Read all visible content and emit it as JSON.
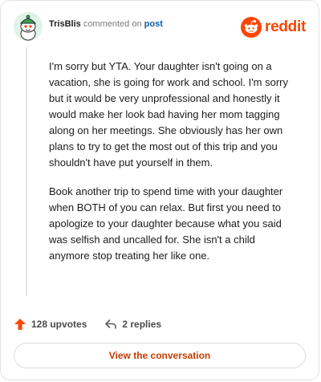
{
  "header": {
    "username": "TrisBlis",
    "commented_text": "commented on",
    "post_link": "post"
  },
  "brand": {
    "wordmark": "reddit",
    "color": "#ff4500"
  },
  "comment": {
    "paragraphs": [
      "I'm sorry but YTA. Your daughter isn't going on a vacation, she is going for work and school. I'm sorry but it would be very unprofessional and honestly it would make her look bad having her mom tagging along on her meetings. She obviously has her own plans to try to get the most out of this trip and you shouldn't have put yourself in them.",
      "Book another trip to spend time with your daughter when BOTH of you can relax. But first you need to apologize to your daughter because what you said was selfish and uncalled for. She isn't a child anymore stop treating her like one."
    ]
  },
  "actions": {
    "upvotes_label": "128 upvotes",
    "replies_label": "2 replies",
    "upvote_icon": "upvote-arrow-icon",
    "reply_icon": "reply-arrow-icon"
  },
  "cta": {
    "label": "View the conversation"
  }
}
